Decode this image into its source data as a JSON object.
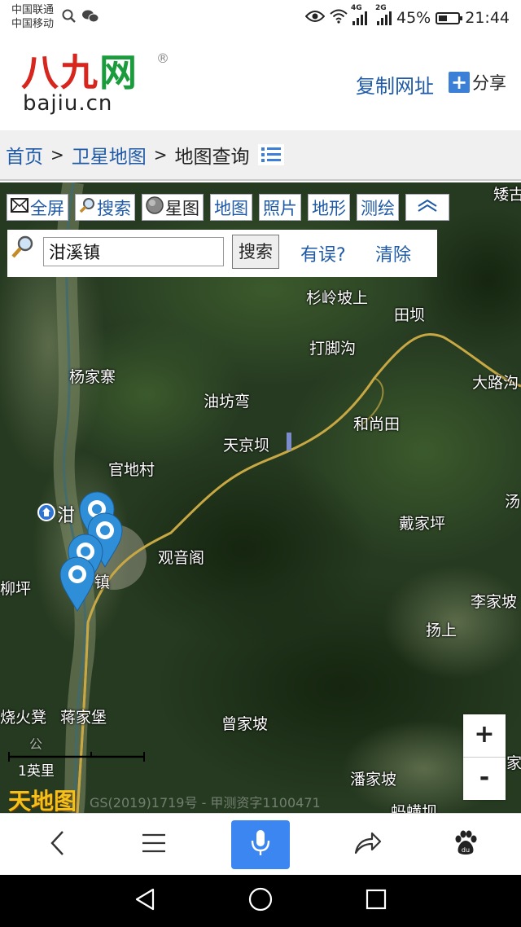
{
  "status_bar": {
    "carrier1": "中国联通",
    "carrier2": "中国移动",
    "net1": "4G",
    "net2": "2G",
    "battery_level": 0.45,
    "battery": "45%",
    "time": "21:44"
  },
  "header": {
    "logo_cn": [
      "八",
      "九",
      "网"
    ],
    "logo_en": "bajiu.cn",
    "logo_reg": "®",
    "copy_url": "复制网址",
    "share": "分享"
  },
  "breadcrumb": {
    "home": "首页",
    "sep": ">",
    "satellite": "卫星地图",
    "current": "地图查询"
  },
  "map": {
    "toolbar": {
      "fullscreen": "全屏",
      "search": "搜索",
      "star": "星图",
      "map": "地图",
      "photo": "照片",
      "terrain": "地形",
      "survey": "测绘"
    },
    "search": {
      "value": "泔溪镇",
      "button": "搜索",
      "error": "有误?",
      "clear": "清除"
    },
    "places": [
      "矮古",
      "杉岭坡上",
      "田坝",
      "打脚沟",
      "杨家寨",
      "大路沟",
      "油坊弯",
      "和尚田",
      "天京坝",
      "官地村",
      "泔",
      "汤",
      "戴家坪",
      "观音阁",
      "镇",
      "柳坪",
      "李家坡",
      "扬上",
      "烧火凳",
      "蒋家堡",
      "曾家坡",
      "家",
      "潘家坡",
      "蚂蟥坝",
      "公"
    ],
    "zoom_in": "+",
    "zoom_out": "-",
    "scale_label": "1英里",
    "provider_logo": "天地图",
    "copyright": "GS(2019)1719号 - 甲测资字1100471"
  }
}
